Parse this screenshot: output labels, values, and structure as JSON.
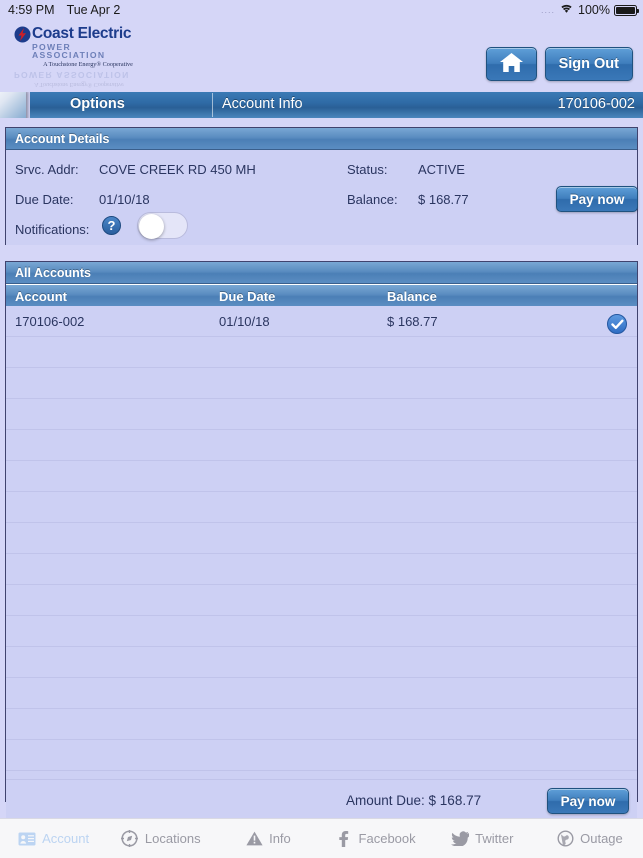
{
  "statusbar": {
    "time": "4:59 PM",
    "date": "Tue Apr 2",
    "dots": "....",
    "wifi_icon": "wifi-icon",
    "battery_pct": "100%",
    "battery_icon": "battery-full-icon"
  },
  "header": {
    "logo": {
      "bolt_icon": "lightning-bolt-icon",
      "name": "Coast Electric",
      "subtitle": "POWER  ASSOCIATION",
      "tagline": "A Touchstone Energy® Cooperative"
    },
    "home_button": {
      "label": "",
      "icon": "home-icon"
    },
    "signout_button": {
      "label": "Sign Out"
    }
  },
  "navbar": {
    "options_label": "Options",
    "title": "Account Info",
    "account_number": "170106-002"
  },
  "details": {
    "panel_title": "Account Details",
    "fields": {
      "srvc_addr_label": "Srvc. Addr:",
      "srvc_addr_value": "COVE CREEK RD 450 MH",
      "due_date_label": "Due Date:",
      "due_date_value": "01/10/18",
      "status_label": "Status:",
      "status_value": "ACTIVE",
      "balance_label": "Balance:",
      "balance_value": "$ 168.77",
      "notifications_label": "Notifications:",
      "help_icon_glyph": "?",
      "notifications_state": "off"
    },
    "pay_now_label": "Pay now"
  },
  "accounts": {
    "panel_title": "All Accounts",
    "columns": [
      "Account",
      "Due Date",
      "Balance"
    ],
    "rows": [
      {
        "account": "170106-002",
        "due_date": "01/10/18",
        "balance": "$ 168.77",
        "selected": true
      }
    ],
    "empty_row_count": 14,
    "footer": {
      "amount_due_label": "Amount Due: $ 168.77",
      "pay_now_label": "Pay now"
    }
  },
  "tabbar": {
    "items": [
      {
        "label": "Account",
        "icon": "contact-card-icon",
        "active": true
      },
      {
        "label": "Locations",
        "icon": "compass-icon",
        "active": false
      },
      {
        "label": "Info",
        "icon": "warning-triangle-icon",
        "active": false
      },
      {
        "label": "Facebook",
        "icon": "facebook-icon",
        "active": false
      },
      {
        "label": "Twitter",
        "icon": "twitter-bird-icon",
        "active": false
      },
      {
        "label": "Outage",
        "icon": "globe-icon",
        "active": false
      }
    ]
  },
  "colors": {
    "page_bg": "#d5d6f7",
    "panel_bg": "#cdd0f4",
    "panel_header_blue": "#5a8cc0",
    "nav_blue": "#2f6ba6",
    "text_navy": "#2a3560",
    "accent_blue": "#2f6dc4",
    "tab_inactive": "#9a9aa4",
    "tab_active": "#bcd4f2"
  }
}
